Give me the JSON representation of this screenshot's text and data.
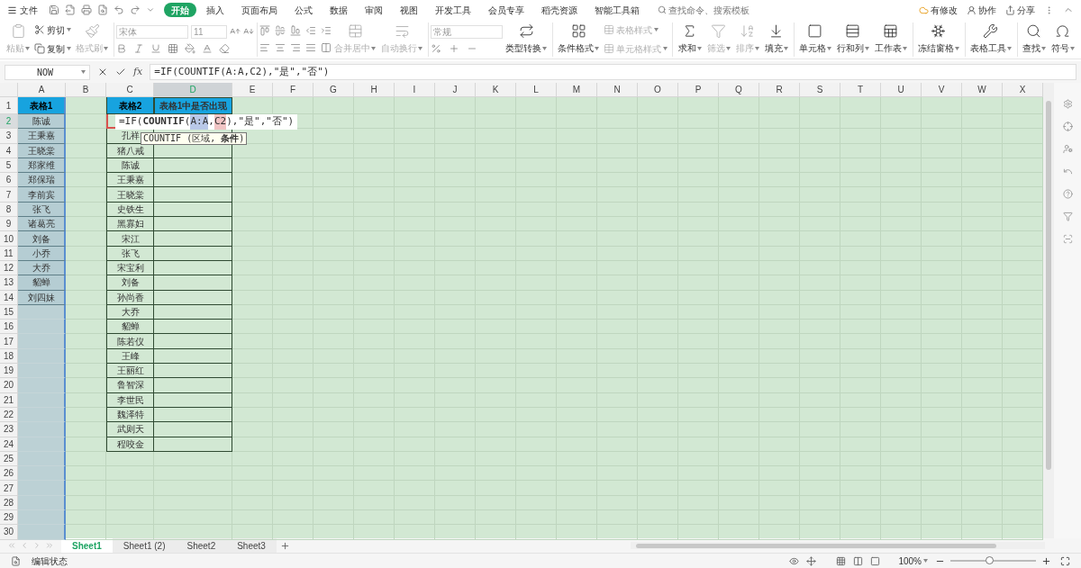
{
  "menu": {
    "file": "文件",
    "tabs": [
      {
        "label": "开始",
        "selected": true
      },
      {
        "label": "插入",
        "selected": false
      },
      {
        "label": "页面布局",
        "selected": false
      },
      {
        "label": "公式",
        "selected": false
      },
      {
        "label": "数据",
        "selected": false
      },
      {
        "label": "审阅",
        "selected": false
      },
      {
        "label": "视图",
        "selected": false
      },
      {
        "label": "开发工具",
        "selected": false
      },
      {
        "label": "会员专享",
        "selected": false
      },
      {
        "label": "稻壳资源",
        "selected": false
      },
      {
        "label": "智能工具箱",
        "selected": false
      }
    ],
    "search": {
      "placeholder": "查找命令、搜索模板"
    },
    "actions": [
      "有修改",
      "协作",
      "分享"
    ]
  },
  "ribbon": {
    "clipboard": [
      {
        "label": "粘贴",
        "disabled": true
      },
      {
        "label": "剪切",
        "disabled": false
      },
      {
        "label": "复制",
        "disabled": false
      },
      {
        "label": "格式刷",
        "disabled": true
      }
    ],
    "font": {
      "name": "宋体",
      "size": "11"
    },
    "alignment": [
      {
        "label": "合并居中",
        "disabled": true
      },
      {
        "label": "自动换行",
        "disabled": true
      }
    ],
    "number": {
      "format": "常规",
      "convert": "类型转换"
    },
    "groups": [
      [
        {
          "kind": "big",
          "label": "条件格式",
          "disabled": false
        },
        {
          "kind": "small",
          "label": "表格样式",
          "disabled": true
        },
        {
          "kind": "small",
          "label": "单元格样式",
          "disabled": true
        }
      ],
      [
        {
          "kind": "big",
          "label": "求和",
          "disabled": false
        },
        {
          "kind": "big",
          "label": "筛选",
          "disabled": true
        },
        {
          "kind": "big",
          "label": "排序",
          "disabled": true
        },
        {
          "kind": "big",
          "label": "填充",
          "disabled": false
        }
      ],
      [
        {
          "kind": "big",
          "label": "单元格",
          "disabled": false
        },
        {
          "kind": "big",
          "label": "行和列",
          "disabled": false
        },
        {
          "kind": "big",
          "label": "工作表",
          "disabled": false
        }
      ],
      [
        {
          "kind": "big",
          "label": "冻结窗格",
          "disabled": false
        }
      ],
      [
        {
          "kind": "big",
          "label": "表格工具",
          "disabled": false
        }
      ],
      [
        {
          "kind": "big",
          "label": "查找",
          "disabled": false
        },
        {
          "kind": "big",
          "label": "符号",
          "disabled": false
        }
      ]
    ]
  },
  "formula_bar": {
    "name_box": "NOW",
    "fx": "fx",
    "formula": "=IF(COUNTIF(A:A,C2),\"是\",\"否\")"
  },
  "sheet": {
    "columns": [
      {
        "label": "A",
        "selected": false
      },
      {
        "label": "B",
        "selected": false
      },
      {
        "label": "C",
        "selected": false
      },
      {
        "label": "D",
        "selected": true
      },
      {
        "label": "E",
        "selected": false
      },
      {
        "label": "F",
        "selected": false
      },
      {
        "label": "G",
        "selected": false
      },
      {
        "label": "H",
        "selected": false
      },
      {
        "label": "I",
        "selected": false
      },
      {
        "label": "J",
        "selected": false
      },
      {
        "label": "K",
        "selected": false
      },
      {
        "label": "L",
        "selected": false
      },
      {
        "label": "M",
        "selected": false
      },
      {
        "label": "N",
        "selected": false
      },
      {
        "label": "O",
        "selected": false
      },
      {
        "label": "P",
        "selected": false
      },
      {
        "label": "Q",
        "selected": false
      },
      {
        "label": "R",
        "selected": false
      },
      {
        "label": "S",
        "selected": false
      },
      {
        "label": "T",
        "selected": false
      },
      {
        "label": "U",
        "selected": false
      },
      {
        "label": "V",
        "selected": false
      },
      {
        "label": "W",
        "selected": false
      },
      {
        "label": "X",
        "selected": false
      }
    ],
    "rows": [
      {
        "label": "1",
        "selected": false
      },
      {
        "label": "2",
        "selected": true
      },
      {
        "label": "3",
        "selected": false
      },
      {
        "label": "4",
        "selected": false
      },
      {
        "label": "5",
        "selected": false
      },
      {
        "label": "6",
        "selected": false
      },
      {
        "label": "7",
        "selected": false
      },
      {
        "label": "8",
        "selected": false
      },
      {
        "label": "9",
        "selected": false
      },
      {
        "label": "10",
        "selected": false
      },
      {
        "label": "11",
        "selected": false
      },
      {
        "label": "12",
        "selected": false
      },
      {
        "label": "13",
        "selected": false
      },
      {
        "label": "14",
        "selected": false
      },
      {
        "label": "15",
        "selected": false
      },
      {
        "label": "16",
        "selected": false
      },
      {
        "label": "17",
        "selected": false
      },
      {
        "label": "18",
        "selected": false
      },
      {
        "label": "19",
        "selected": false
      },
      {
        "label": "20",
        "selected": false
      },
      {
        "label": "21",
        "selected": false
      },
      {
        "label": "22",
        "selected": false
      },
      {
        "label": "23",
        "selected": false
      },
      {
        "label": "24",
        "selected": false
      },
      {
        "label": "25",
        "selected": false
      },
      {
        "label": "26",
        "selected": false
      },
      {
        "label": "27",
        "selected": false
      },
      {
        "label": "28",
        "selected": false
      },
      {
        "label": "29",
        "selected": false
      },
      {
        "label": "30",
        "selected": false
      }
    ],
    "table1": {
      "header": "表格1",
      "items": [
        "陈诚",
        "王秉嘉",
        "王晓棠",
        "郑家维",
        "郑保瑞",
        "李前宾",
        "张飞",
        "诸葛亮",
        "刘备",
        "小乔",
        "大乔",
        "貂蝉",
        "刘四妹"
      ]
    },
    "table2": {
      "header": "表格2",
      "result_header": "表格1中是否出现",
      "items": [
        "孔祥",
        "猪八戒",
        "陈诚",
        "王秉嘉",
        "王晓棠",
        "史铁生",
        "黑寡妇",
        "宋江",
        "张飞",
        "宋宝利",
        "刘备",
        "孙尚香",
        "大乔",
        "貂蝉",
        "陈若仪",
        "王峰",
        "王丽红",
        "鲁智深",
        "李世民",
        "魏泽特",
        "武则天",
        "程咬金"
      ]
    },
    "editor": {
      "parts": [
        {
          "kind": "plain",
          "text": "=IF("
        },
        {
          "kind": "function",
          "text": "COUNTIF"
        },
        {
          "kind": "plain",
          "text": "("
        },
        {
          "kind": "ref",
          "text": "A:A",
          "color": "#b9c8e8"
        },
        {
          "kind": "plain",
          "text": ","
        },
        {
          "kind": "ref",
          "text": "C2",
          "color": "#f0c4c4"
        },
        {
          "kind": "plain",
          "text": "),\"是\",\"否\")"
        }
      ]
    },
    "tooltip": "COUNTIF (区域, **条件**)"
  },
  "sheet_tabs": [
    {
      "label": "Sheet1",
      "selected": true
    },
    {
      "label": "Sheet1 (2)",
      "selected": false
    },
    {
      "label": "Sheet2",
      "selected": false
    },
    {
      "label": "Sheet3",
      "selected": false
    }
  ],
  "status_bar": {
    "mode": "编辑状态",
    "zoom": "100%",
    "zoom_slider": {
      "level": 0.45
    }
  }
}
